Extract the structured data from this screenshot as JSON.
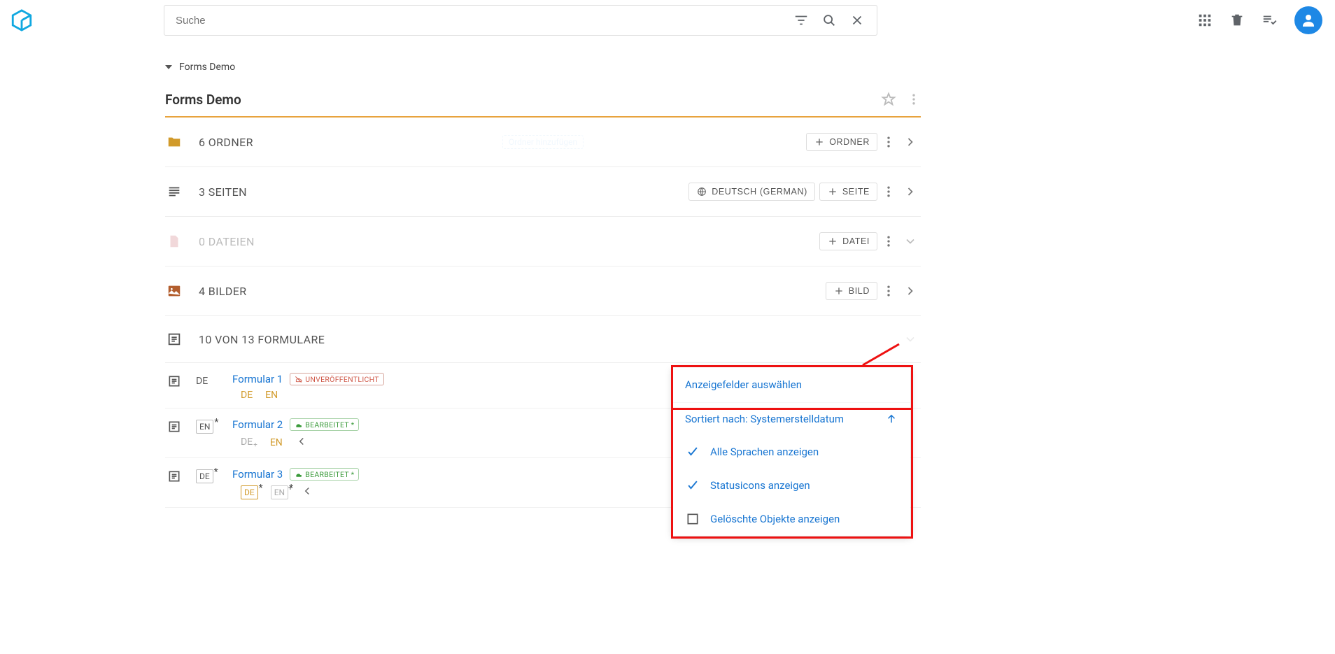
{
  "search": {
    "placeholder": "Suche"
  },
  "breadcrumb": {
    "project": "Forms Demo"
  },
  "page": {
    "title": "Forms Demo"
  },
  "sections": {
    "folders": {
      "label": "6 ORDNER",
      "add_label": "ORDNER"
    },
    "pages": {
      "label": "3 SEITEN",
      "add_label": "SEITE",
      "lang_label": "DEUTSCH (GERMAN)"
    },
    "files": {
      "label": "0 DATEIEN",
      "add_label": "DATEI"
    },
    "images": {
      "label": "4 BILDER",
      "add_label": "BILD"
    },
    "forms": {
      "label": "10 VON 13 FORMULARE"
    }
  },
  "status": {
    "unpublished": "UNVERÖFFENTLICHT",
    "edited": "BEARBEITET *"
  },
  "forms": [
    {
      "chip": "DE",
      "chip_asterisk": false,
      "chip_plus": false,
      "chip_border": false,
      "title": "Formular 1",
      "status": "unpublished",
      "langs": [
        {
          "code": "DE",
          "cls": "de-active"
        },
        {
          "code": "EN",
          "cls": "en-active"
        }
      ],
      "back": false
    },
    {
      "chip": "EN",
      "chip_asterisk": true,
      "chip_plus": false,
      "chip_border": true,
      "title": "Formular 2",
      "status": "edited",
      "langs": [
        {
          "code": "DE",
          "cls": "lang-muted",
          "plus": true
        },
        {
          "code": "EN",
          "cls": "en-active"
        }
      ],
      "back": true
    },
    {
      "chip": "DE",
      "chip_asterisk": true,
      "chip_plus": false,
      "chip_border": true,
      "title": "Formular 3",
      "status": "edited",
      "langs": [
        {
          "code": "DE",
          "cls": "de-active",
          "border": true,
          "asterisk": true
        },
        {
          "code": "EN",
          "cls": "lang-muted",
          "border": true,
          "asterisk": true,
          "plus": true
        }
      ],
      "back": true
    }
  ],
  "popup": {
    "select_fields": "Anzeigefelder auswählen",
    "sort_label": "Sortiert nach: Systemerstelldatum",
    "opt_all_langs": "Alle Sprachen anzeigen",
    "opt_status_icons": "Statusicons anzeigen",
    "opt_deleted": "Gelöschte Objekte anzeigen"
  }
}
